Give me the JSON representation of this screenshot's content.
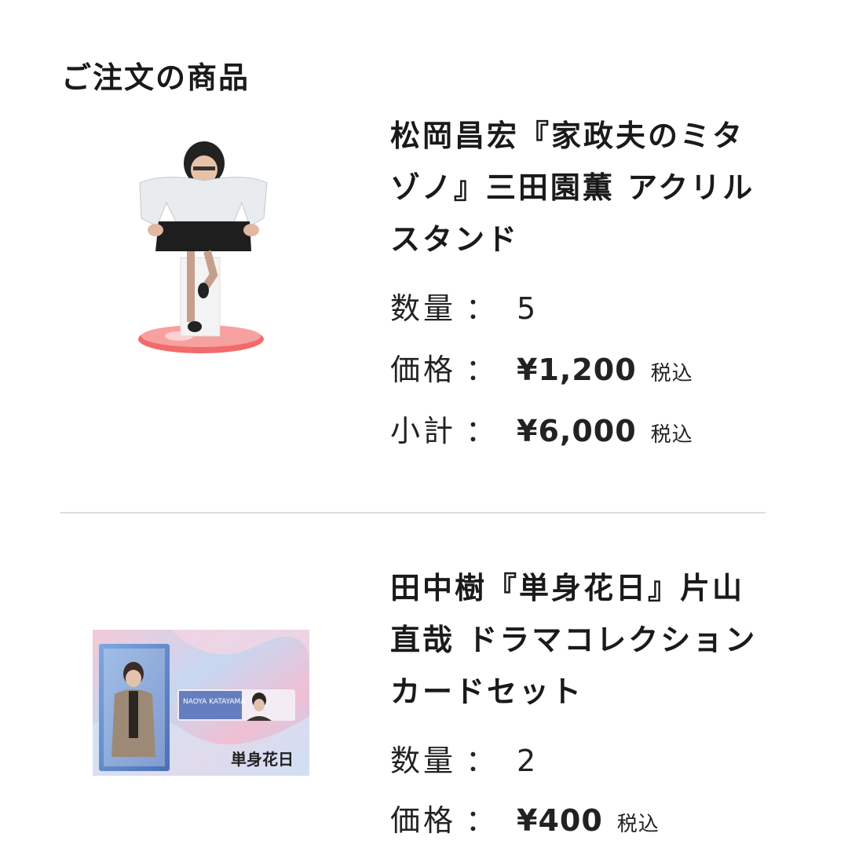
{
  "page": {
    "section_title": "ご注文の商品"
  },
  "items": [
    {
      "name": "松岡昌宏『家政夫のミタゾノ』三田園薫 アクリルスタンド",
      "quantity_label": "数量",
      "quantity": "5",
      "price_label": "価格",
      "price": "¥1,200",
      "price_tax": "税込",
      "subtotal_label": "小計",
      "subtotal": "¥6,000",
      "subtotal_tax": "税込",
      "image_icon": "acrylic-stand-photo"
    },
    {
      "name": "田中樹『単身花日』片山直哉 ドラマコレクションカードセット",
      "quantity_label": "数量",
      "quantity": "2",
      "price_label": "価格",
      "price": "¥400",
      "price_tax": "税込",
      "image_icon": "card-set-photo",
      "card_text_1": "NAOYA KATAYAMA",
      "card_text_2": "単身花日"
    }
  ],
  "colors": {
    "divider": "#dddddd",
    "text": "#1a1a1a",
    "stand_base": "#f05a5a"
  }
}
